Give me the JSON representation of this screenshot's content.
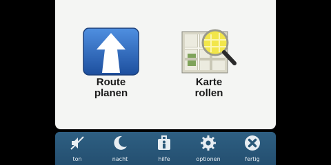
{
  "main_menu": {
    "items": [
      {
        "label_line1": "Route",
        "label_line2": "planen",
        "icon": "route-arrow-icon"
      },
      {
        "label_line1": "Karte",
        "label_line2": "rollen",
        "icon": "map-magnifier-icon"
      }
    ]
  },
  "toolbar": {
    "items": [
      {
        "label": "ton",
        "icon": "sound-off-icon"
      },
      {
        "label": "nacht",
        "icon": "moon-icon"
      },
      {
        "label": "hilfe",
        "icon": "help-kit-icon"
      },
      {
        "label": "optionen",
        "icon": "gear-icon"
      },
      {
        "label": "fertig",
        "icon": "close-icon"
      }
    ]
  },
  "colors": {
    "background": "#000000",
    "panel": "#f4f5f3",
    "toolbar": "#2a5878",
    "route_icon": "#2b6cc4",
    "magnifier": "#f2e64a"
  }
}
